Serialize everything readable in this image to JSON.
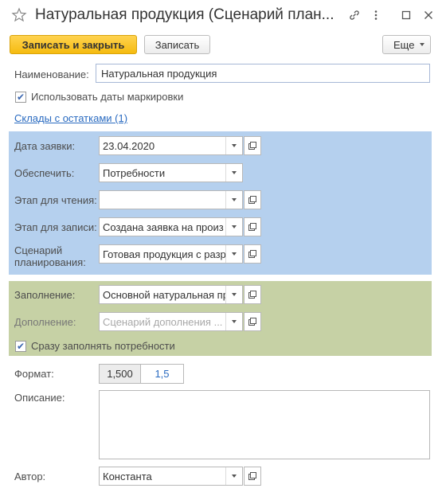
{
  "window": {
    "title": "Натуральная продукция (Сценарий план..."
  },
  "toolbar": {
    "save_close_label": "Записать и закрыть",
    "save_label": "Записать",
    "more_label": "Еще"
  },
  "form": {
    "name_label": "Наименование:",
    "name_value": "Натуральная продукция",
    "use_dates_label": "Использовать даты маркировки",
    "use_dates_checked": true,
    "warehouses_link": "Склады с остатками (1)",
    "request_date_label": "Дата заявки:",
    "request_date_value": "23.04.2020",
    "provide_label": "Обеспечить:",
    "provide_value": "Потребности",
    "read_stage_label": "Этап для чтения:",
    "read_stage_value": "",
    "write_stage_label": "Этап для записи:",
    "write_stage_value": "Создана заявка на произ",
    "scenario_label_line1": "Сценарий",
    "scenario_label_line2": "планирования:",
    "scenario_value": "Готовая продукция с разр",
    "fill_label": "Заполнение:",
    "fill_value": "Основной натуральная пр",
    "addition_label": "Дополнение:",
    "addition_placeholder": "Сценарий дополнения ...",
    "fill_needs_label": "Сразу заполнять потребности",
    "fill_needs_checked": true,
    "format_label": "Формат:",
    "format_options": [
      "1,500",
      "1,5"
    ],
    "description_label": "Описание:",
    "description_value": "",
    "author_label": "Автор:",
    "author_value": "Константа"
  },
  "colors": {
    "primary_button": "#f5bb10",
    "panel_blue": "#b5d0ee",
    "panel_green": "#c6d1a5",
    "link": "#2a6bc1"
  },
  "icons": [
    "star-icon",
    "link-icon",
    "more-vert-icon",
    "maximize-icon",
    "close-icon",
    "chevron-down-icon",
    "open-icon",
    "check-icon"
  ]
}
